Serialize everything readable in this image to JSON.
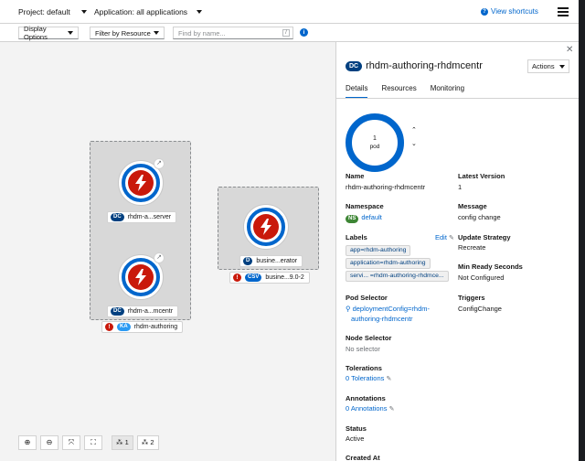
{
  "topbar": {
    "project_label": "Project: default",
    "application_label": "Application: all applications",
    "shortcuts_label": "View shortcuts"
  },
  "toolbar": {
    "display_options": "Display Options",
    "filter_by_resource": "Filter by Resource",
    "search_placeholder": "Find by name...",
    "search_key_hint": "/"
  },
  "canvas": {
    "groups": [
      {
        "name": "rhdm-authoring",
        "badge": "KA",
        "nodes": [
          {
            "badge": "DC",
            "label": "rhdm-a...server"
          },
          {
            "badge": "DC",
            "label": "rhdm-a...mcentr"
          }
        ]
      },
      {
        "name": "busine...9.0-2",
        "badge": "CSV",
        "nodes": [
          {
            "badge": "D",
            "label": "busine...erator"
          }
        ]
      }
    ],
    "controls": {
      "zoom_in": "⊕",
      "zoom_out": "⊖",
      "fit": "⤧",
      "reset": "⛶",
      "layout1": "1",
      "layout2": "2"
    }
  },
  "panel": {
    "badge": "DC",
    "title": "rhdm-authoring-rhdmcentr",
    "actions_label": "Actions",
    "tabs": [
      "Details",
      "Resources",
      "Monitoring"
    ],
    "donut": {
      "count": "1",
      "unit": "pod"
    },
    "fields": {
      "name_label": "Name",
      "name_value": "rhdm-authoring-rhdmcentr",
      "latest_version_label": "Latest Version",
      "latest_version_value": "1",
      "namespace_label": "Namespace",
      "namespace_badge": "NS",
      "namespace_value": "default",
      "message_label": "Message",
      "message_value": "config change",
      "labels_label": "Labels",
      "edit_label": "Edit",
      "labels": [
        "app=rhdm-authoring",
        "application=rhdm-authoring",
        "servi... =rhdm-authoring-rhdmce..."
      ],
      "update_strategy_label": "Update Strategy",
      "update_strategy_value": "Recreate",
      "min_ready_label": "Min Ready Seconds",
      "min_ready_value": "Not Configured",
      "pod_selector_label": "Pod Selector",
      "pod_selector_value_line1": "deploymentConfig=rhdm-",
      "pod_selector_value_line2": "authoring-rhdmcentr",
      "triggers_label": "Triggers",
      "triggers_value": "ConfigChange",
      "node_selector_label": "Node Selector",
      "node_selector_value": "No selector",
      "tolerations_label": "Tolerations",
      "tolerations_value": "0 Tolerations",
      "annotations_label": "Annotations",
      "annotations_value": "0 Annotations",
      "status_label": "Status",
      "status_value": "Active",
      "created_label": "Created At"
    }
  }
}
